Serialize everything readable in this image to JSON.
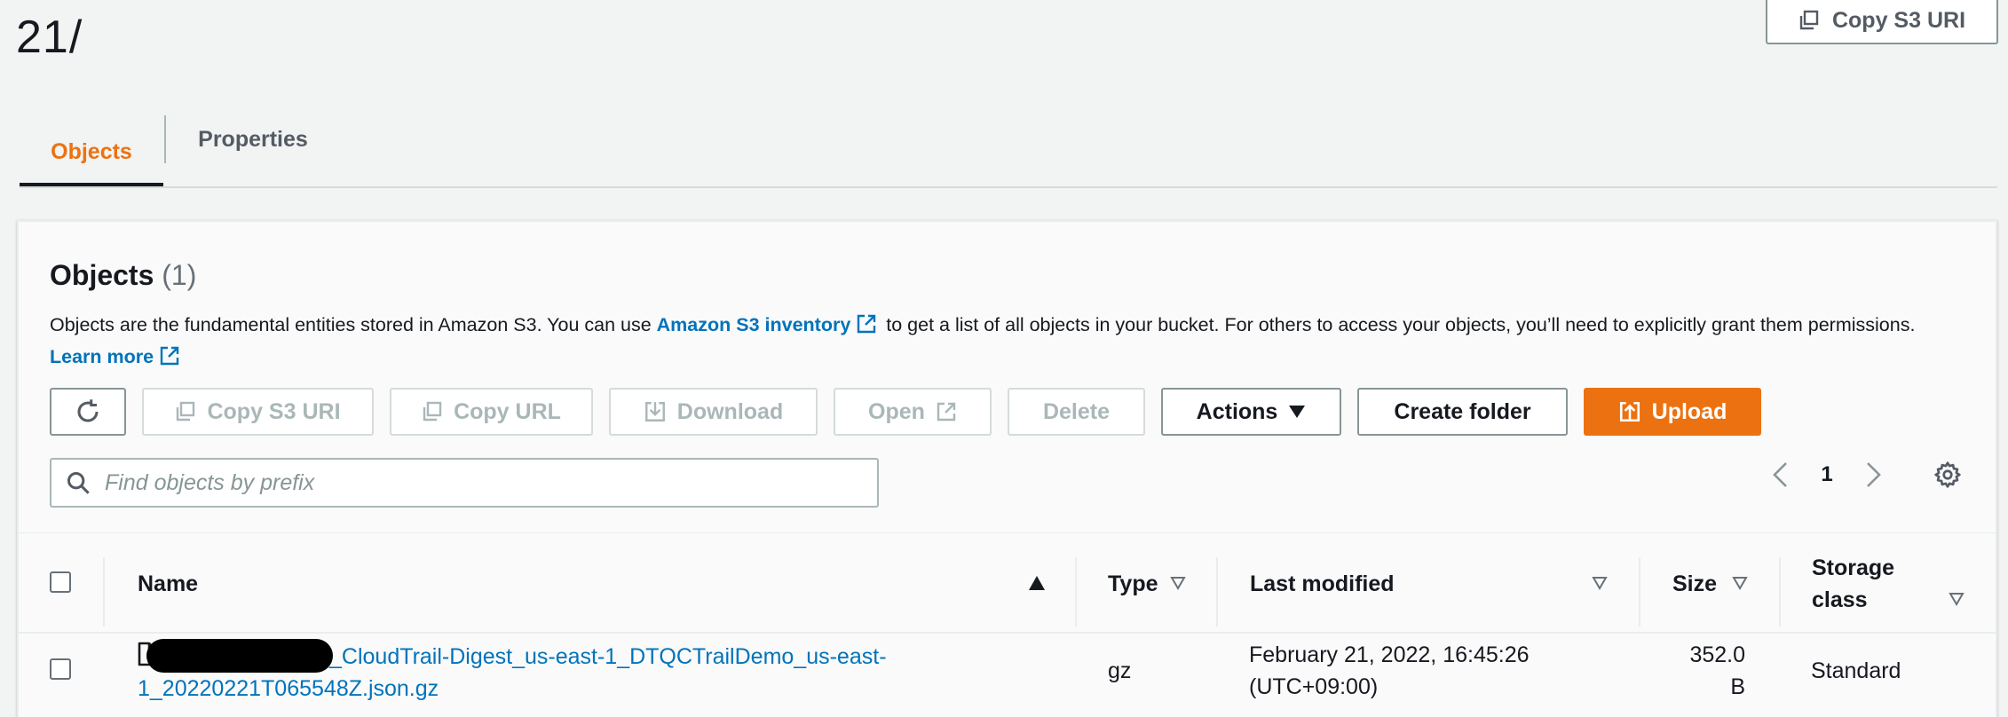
{
  "header": {
    "title": "21/",
    "copy_uri_label": "Copy S3 URI"
  },
  "tabs": [
    {
      "label": "Objects",
      "active": true
    },
    {
      "label": "Properties",
      "active": false
    }
  ],
  "objects_panel": {
    "heading": "Objects",
    "count": "(1)",
    "desc_part1": "Objects are the fundamental entities stored in Amazon S3. You can use ",
    "inventory_link": "Amazon S3 inventory",
    "desc_part2": " to get a list of all objects in your bucket. For others to access your objects, you’ll need to explicitly grant them permissions. ",
    "learn_more": "Learn more"
  },
  "toolbar": {
    "copy_s3_uri": "Copy S3 URI",
    "copy_url": "Copy URL",
    "download": "Download",
    "open": "Open",
    "delete": "Delete",
    "actions": "Actions",
    "create_folder": "Create folder",
    "upload": "Upload"
  },
  "search": {
    "placeholder": "Find objects by prefix",
    "value": ""
  },
  "pagination": {
    "current_page": "1"
  },
  "table": {
    "columns": {
      "name": "Name",
      "type": "Type",
      "last_modified": "Last modified",
      "size": "Size",
      "storage_class_line1": "Storage",
      "storage_class_line2": "class"
    },
    "rows": [
      {
        "name_line1": "_CloudTrail-Digest_us-east-1_DTQCTrailDemo_us-east-",
        "name_line2": "1_20220221T065548Z.json.gz",
        "type": "gz",
        "last_modified_line1": "February 21, 2022, 16:45:26",
        "last_modified_line2": "(UTC+09:00)",
        "size_line1": "352.0",
        "size_line2": "B",
        "storage_class": "Standard"
      }
    ]
  },
  "colors": {
    "accent": "#ec7211",
    "link": "#0073bb",
    "text": "#16191f",
    "muted": "#545b64"
  }
}
